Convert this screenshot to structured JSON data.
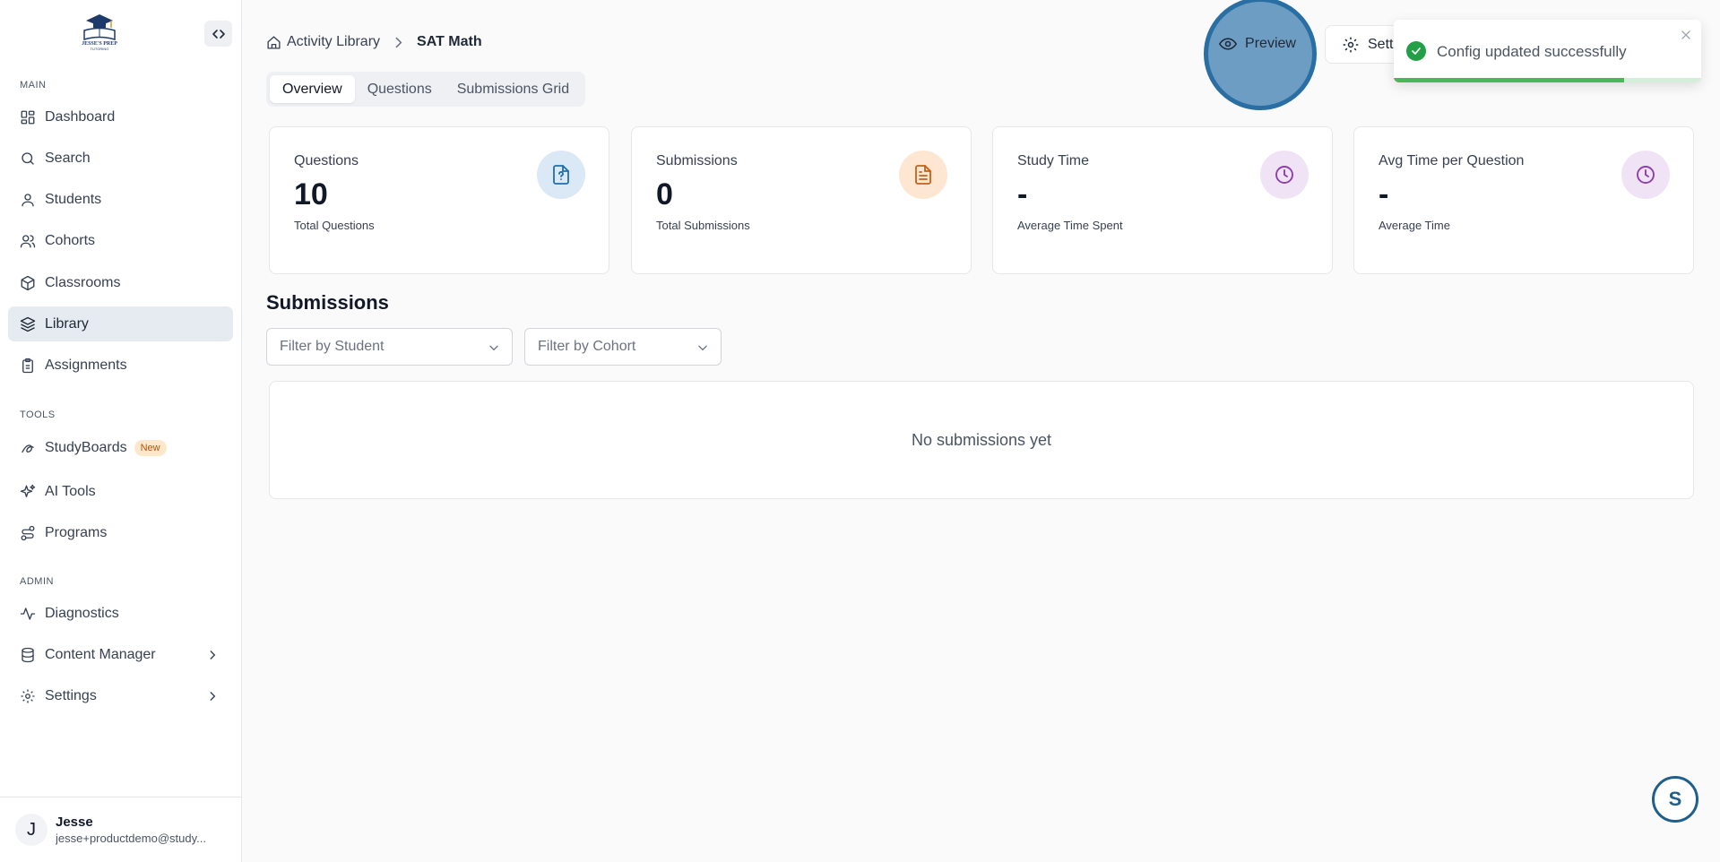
{
  "brand": {
    "logo_text": "JESSE'S PREP",
    "logo_subtext": "TUTORING"
  },
  "sidebar": {
    "sections": {
      "main": "MAIN",
      "tools": "TOOLS",
      "admin": "ADMIN"
    },
    "items": [
      {
        "label": "Dashboard",
        "icon": "dashboard-icon"
      },
      {
        "label": "Search",
        "icon": "search-icon"
      },
      {
        "label": "Students",
        "icon": "user-icon"
      },
      {
        "label": "Cohorts",
        "icon": "users-icon"
      },
      {
        "label": "Classrooms",
        "icon": "box-icon"
      },
      {
        "label": "Library",
        "icon": "layers-icon",
        "active": true
      },
      {
        "label": "Assignments",
        "icon": "clipboard-icon"
      },
      {
        "label": "StudyBoards",
        "icon": "studyboards-icon",
        "badge": "New"
      },
      {
        "label": "AI Tools",
        "icon": "sparkles-icon"
      },
      {
        "label": "Programs",
        "icon": "route-icon"
      },
      {
        "label": "Diagnostics",
        "icon": "activity-icon"
      },
      {
        "label": "Content Manager",
        "icon": "database-icon"
      },
      {
        "label": "Settings",
        "icon": "gear-icon"
      }
    ],
    "user": {
      "initial": "J",
      "name": "Jesse",
      "email": "jesse+productdemo@study..."
    }
  },
  "header": {
    "breadcrumb": {
      "root": "Activity Library",
      "current": "SAT Math"
    },
    "preview_label": "Preview",
    "settings_label": "Setti"
  },
  "tabs": [
    {
      "label": "Overview",
      "active": true
    },
    {
      "label": "Questions"
    },
    {
      "label": "Submissions Grid"
    }
  ],
  "toast": {
    "message": "Config updated successfully",
    "progress": 0.75
  },
  "stats": [
    {
      "title": "Questions",
      "value": "10",
      "sub": "Total Questions",
      "icon": "question-file-icon",
      "color": "#1e6fb0",
      "bg": "#dbe9f6"
    },
    {
      "title": "Submissions",
      "value": "0",
      "sub": "Total Submissions",
      "icon": "document-icon",
      "color": "#c2621a",
      "bg": "#fde7d2"
    },
    {
      "title": "Study Time",
      "value": "-",
      "sub": "Average Time Spent",
      "icon": "clock-icon",
      "color": "#8e3fa8",
      "bg": "#f1e3f6"
    },
    {
      "title": "Avg Time per Question",
      "value": "-",
      "sub": "Average Time",
      "icon": "clock-icon",
      "color": "#8e3fa8",
      "bg": "#f1e3f6"
    }
  ],
  "submissions": {
    "title": "Submissions",
    "filter_student": "Filter by Student",
    "filter_cohort": "Filter by Cohort",
    "empty_text": "No submissions yet"
  },
  "help": {
    "label": "S"
  }
}
